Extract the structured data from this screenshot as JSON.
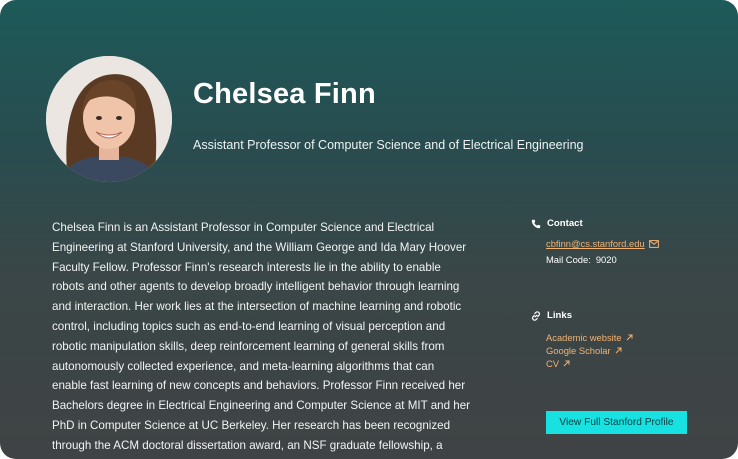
{
  "profile": {
    "name": "Chelsea Finn",
    "title": "Assistant Professor of Computer Science and of Electrical Engineering",
    "photo_icon": "portrait-photo"
  },
  "bio": "Chelsea Finn is an Assistant Professor in Computer Science and Electrical Engineering at Stanford University, and the William George and Ida Mary Hoover Faculty Fellow. Professor Finn's research interests lie in the ability to enable robots and other agents to develop broadly intelligent behavior through learning and interaction. Her work lies at the intersection of machine learning and robotic control, including topics such as end-to-end learning of visual perception and robotic manipulation skills, deep reinforcement learning of general skills from autonomously collected experience, and meta-learning algorithms that can enable fast learning of new concepts and behaviors. Professor Finn received her Bachelors degree in Electrical Engineering and Computer Science at MIT and her PhD in Computer Science at UC Berkeley. Her research has been recognized through the ACM doctoral dissertation award, an NSF graduate fellowship, a Facebook",
  "contact": {
    "heading": "Contact",
    "heading_icon": "phone-icon",
    "email": "cbfinn@cs.stanford.edu",
    "email_icon": "envelope-icon",
    "mail_code_label": "Mail Code:",
    "mail_code": "9020"
  },
  "links": {
    "heading": "Links",
    "heading_icon": "link-icon",
    "items": [
      {
        "label": "Academic website",
        "icon": "external-arrow-icon"
      },
      {
        "label": "Google Scholar",
        "icon": "external-arrow-icon"
      },
      {
        "label": "CV",
        "icon": "external-arrow-icon"
      }
    ]
  },
  "button": {
    "label": "View Full Stanford Profile"
  },
  "colors": {
    "link": "#f2b272",
    "button_bg": "#18e1e2",
    "gradient_top": "#1d5a59",
    "gradient_bottom": "#404345"
  }
}
